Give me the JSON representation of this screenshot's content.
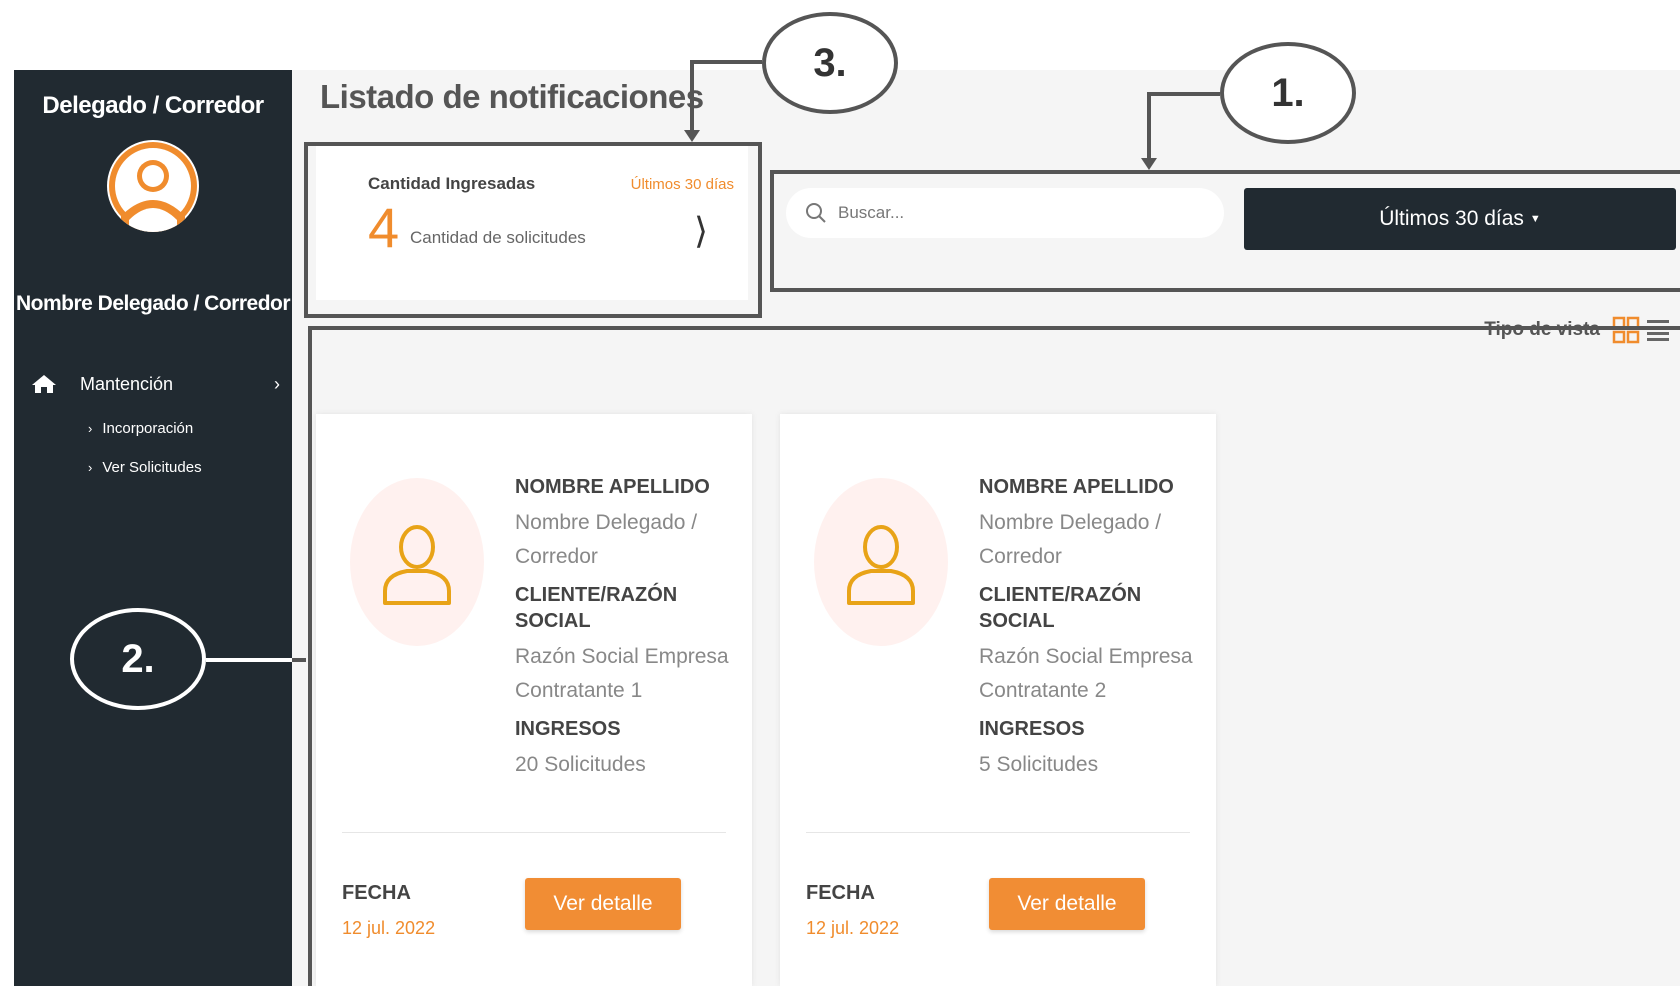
{
  "sidebar": {
    "role_title": "Delegado / Corredor",
    "user_name": "Nombre Delegado / Corredor",
    "menu": {
      "main_label": "Mantención",
      "sub_items": [
        {
          "label": "Incorporación"
        },
        {
          "label": "Ver Solicitudes"
        }
      ]
    }
  },
  "header": {
    "title": "Listado de notificaciones"
  },
  "stats": {
    "label": "Cantidad Ingresadas",
    "period": "Últimos 30 días",
    "count": "4",
    "sublabel": "Cantidad de solicitudes",
    "arrow": "⟩"
  },
  "filters": {
    "search_placeholder": "Buscar...",
    "period_button": "Últimos 30 días"
  },
  "view_toggle": {
    "label": "Tipo de vista"
  },
  "cards": [
    {
      "name_heading": "NOMBRE APELLIDO",
      "name_value": "Nombre Delegado / Corredor",
      "client_heading": "CLIENTE/RAZÓN SOCIAL",
      "client_value": "Razón Social Empresa Contratante 1",
      "income_heading": "INGRESOS",
      "income_value": "20 Solicitudes",
      "date_label": "FECHA",
      "date_value": "12 jul. 2022",
      "button_label": "Ver detalle"
    },
    {
      "name_heading": "NOMBRE APELLIDO",
      "name_value": "Nombre Delegado / Corredor",
      "client_heading": "CLIENTE/RAZÓN SOCIAL",
      "client_value": "Razón Social Empresa Contratante 2",
      "income_heading": "INGRESOS",
      "income_value": "5 Solicitudes",
      "date_label": "FECHA",
      "date_value": "12 jul. 2022",
      "button_label": "Ver detalle"
    }
  ],
  "annotations": {
    "one": "1.",
    "two": "2.",
    "three": "3."
  },
  "colors": {
    "sidebar_bg": "#212a31",
    "accent_orange": "#f08c2d",
    "button_orange": "#f18d34",
    "annotation_gray": "#555555"
  },
  "icons": {
    "home": "home-icon",
    "search": "search-icon",
    "grid_view": "grid-view-icon",
    "list_view": "list-view-icon",
    "user": "user-icon"
  }
}
